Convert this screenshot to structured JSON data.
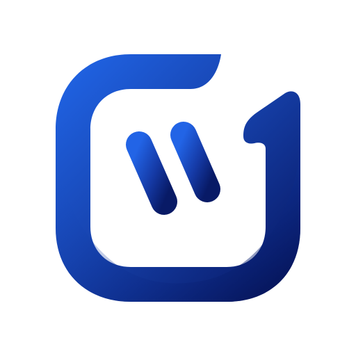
{
  "logo": {
    "description_icon": "stylized-g-logo-icon",
    "colors": {
      "gradient_light": "#1f63e6",
      "gradient_mid": "#1748b8",
      "gradient_dark": "#0a1f6e",
      "gradient_darkest": "#06125a",
      "background": "#ffffff"
    }
  }
}
